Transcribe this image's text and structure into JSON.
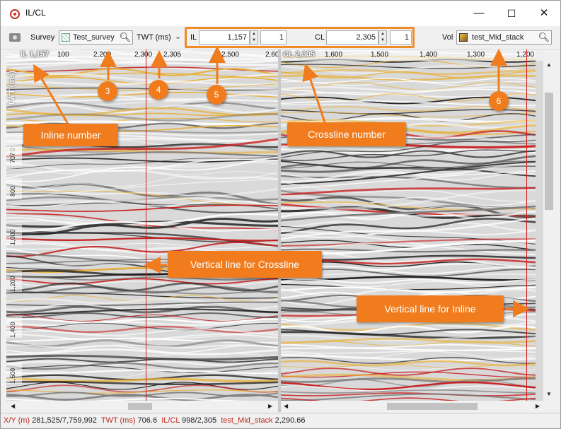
{
  "window": {
    "title": "IL/CL",
    "minimize": "—",
    "maximize": "☐",
    "close": "✕"
  },
  "toolbar": {
    "survey_label": "Survey",
    "survey_value": "Test_survey",
    "zdomain_value": "TWT (ms)",
    "il_label": "IL",
    "il_value": "1,157",
    "il_step": "1",
    "cl_label": "CL",
    "cl_value": "2,305",
    "cl_step": "1",
    "vol_label": "Vol",
    "vol_value": "test_Mid_stack"
  },
  "left_panel": {
    "label": "IL 1,157",
    "axis_title": "TWT (ms)",
    "top_ticks": [
      "100",
      "2,200",
      "2,300",
      "2,305",
      "2,500",
      "2,60"
    ],
    "y_ticks": [
      "0",
      "707",
      "800",
      "1,000",
      "1,200",
      "1,400",
      "1,600"
    ]
  },
  "right_panel": {
    "label": "CL 2,305",
    "top_ticks": [
      "1,600",
      "1,500",
      "1,400",
      "1,300",
      "1,200"
    ]
  },
  "annotations": {
    "callouts": [
      {
        "text": "Inline number"
      },
      {
        "text": "Crossline number"
      },
      {
        "text": "Vertical line for Crossline"
      },
      {
        "text": "Vertical line for Inline"
      }
    ],
    "numbers": [
      "3",
      "4",
      "5",
      "6"
    ]
  },
  "status": {
    "xy_label": "X/Y (m)",
    "xy_value": "281,525/7,759,992",
    "twt_label": "TWT (ms)",
    "twt_value": "706.6",
    "ilcl_label": "IL/CL",
    "ilcl_value": "998/2,305",
    "vol_label": "test_Mid_stack",
    "vol_value": "2,290.66"
  },
  "colors": {
    "accent": "#f07c1e",
    "marker_line": "#d21818",
    "highlight_box": "#f08c28"
  },
  "icons": [
    "target-app-icon",
    "camera-icon",
    "grid-survey-icon",
    "search-icon",
    "chevron-down-icon",
    "volume-cube-icon"
  ]
}
